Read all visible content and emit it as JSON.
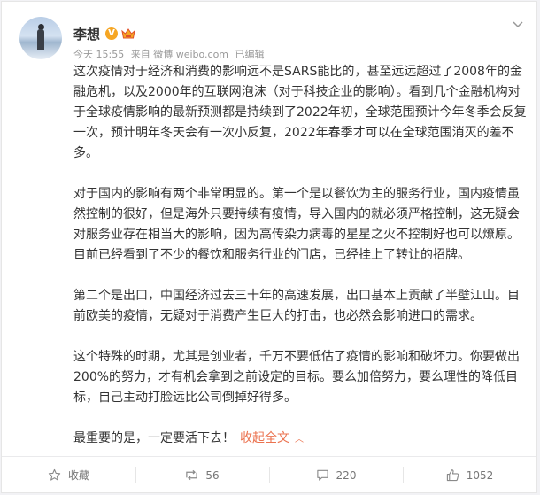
{
  "post": {
    "author": "李想",
    "time": "今天 15:55",
    "source": "来自 微博 weibo.com",
    "edited": "已编辑",
    "paragraphs": [
      "这次疫情对于经济和消费的影响远不是SARS能比的，甚至远远超过了2008年的金融危机，以及2000年的互联网泡沫（对于科技企业的影响）。看到几个金融机构对于全球疫情影响的最新预测都是持续到了2022年初，全球范围预计今年冬季会反复一次，预计明年冬天会有一次小反复，2022年春季才可以在全球范围消灭的差不多。",
      "对于国内的影响有两个非常明显的。第一个是以餐饮为主的服务行业，国内疫情虽然控制的很好，但是海外只要持续有疫情，导入国内的就必须严格控制，这无疑会对服务业存在相当大的影响，因为高传染力病毒的星星之火不控制好也可以燎原。目前已经看到了不少的餐饮和服务行业的门店，已经挂上了转让的招牌。",
      "第二个是出口，中国经济过去三十年的高速发展，出口基本上贡献了半壁江山。目前欧美的疫情，无疑对于消费产生巨大的打击，也必然会影响进口的需求。",
      "这个特殊的时期，尤其是创业者，千万不要低估了疫情的影响和破坏力。你要做出200%的努力，才有机会拿到之前设定的目标。要么加倍努力，要么理性的降低目标，自己主动打脸远比公司倒掉好得多。",
      "最重要的是，一定要活下去！"
    ],
    "collapse_label": "收起全文",
    "collapse_caret": "︿"
  },
  "actions": {
    "favorite": "收藏",
    "repost": "56",
    "comment": "220",
    "like": "1052"
  },
  "icons": {
    "verified": "v-badge-icon",
    "crown": "crown-icon",
    "menu": "chevron-down-icon",
    "favorite": "star-icon",
    "repost": "repost-icon",
    "comment": "comment-icon",
    "like": "thumbs-up-icon"
  },
  "colors": {
    "accent": "#eb7350",
    "badge": "#f6a623",
    "muted": "#999999"
  }
}
